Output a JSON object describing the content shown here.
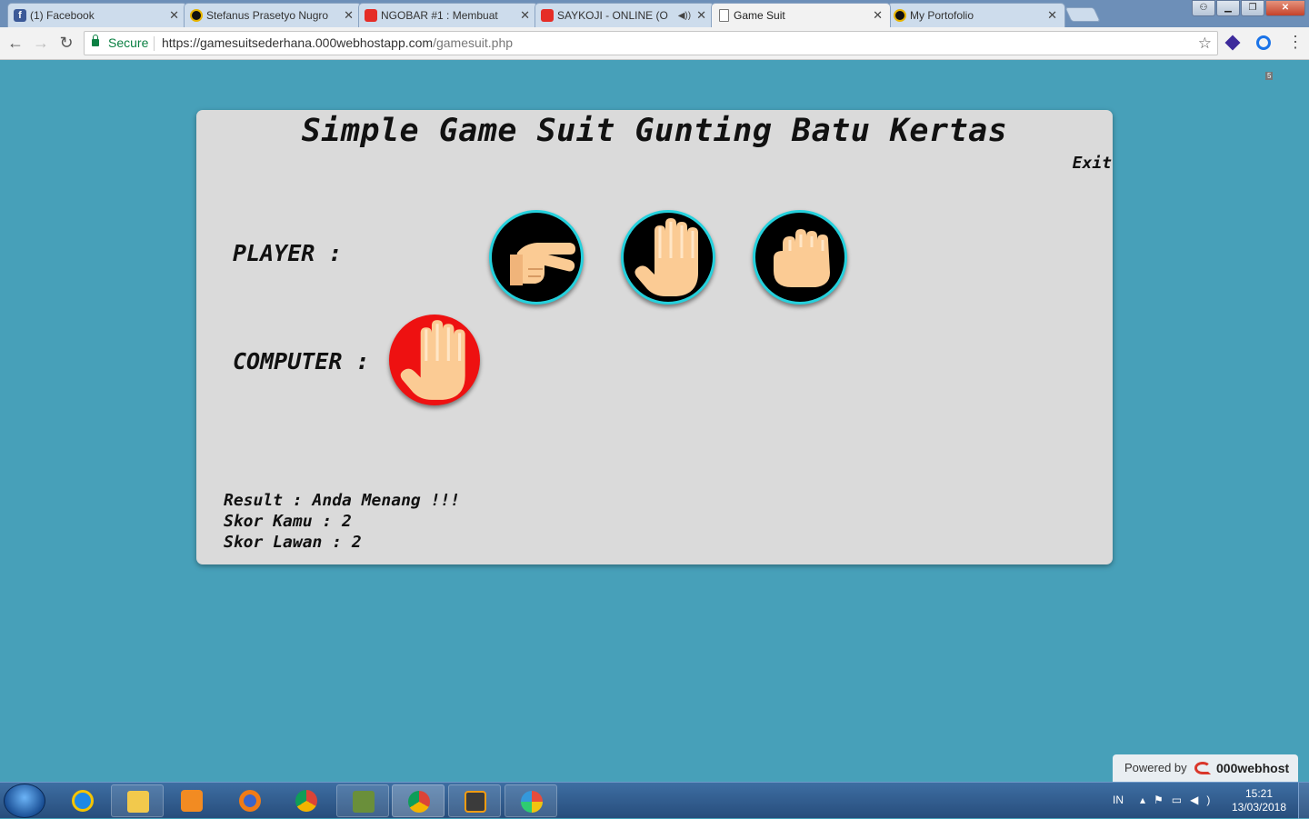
{
  "browser": {
    "tabs": [
      {
        "title": "(1) Facebook",
        "favicon": "facebook-icon",
        "active": false
      },
      {
        "title": "Stefanus Prasetyo Nugro",
        "favicon": "incredibles-icon",
        "active": false
      },
      {
        "title": "NGOBAR #1 : Membuat",
        "favicon": "youtube-icon",
        "active": false
      },
      {
        "title": "SAYKOJI - ONLINE (O",
        "favicon": "youtube-icon",
        "active": false
      },
      {
        "title": "Game Suit",
        "favicon": "document-icon",
        "active": true
      },
      {
        "title": "My Portofolio",
        "favicon": "incredibles-icon",
        "active": false
      }
    ],
    "secure_label": "Secure",
    "url_host": "https://gamesuitsederhana.000webhostapp.com",
    "url_path": "/gamesuit.php",
    "extension_badge": "5"
  },
  "game": {
    "title": "Simple Game Suit Gunting Batu Kertas",
    "exit_label": "Exit",
    "player_label": "PLAYER :",
    "computer_label": "COMPUTER :",
    "player_choices": [
      "scissors-hand-icon",
      "paper-hand-icon",
      "rock-hand-icon"
    ],
    "computer_choice": "paper-hand-icon",
    "result_line": "Result : Anda Menang !!!",
    "score_you_line": "Skor Kamu : 2",
    "score_opponent_line": "Skor Lawan : 2",
    "colors": {
      "background": "#47a0b9",
      "card": "#dadada",
      "choice_ring": "#25d1dd",
      "computer_circle": "#ee1111",
      "skin": "#fbcb94"
    }
  },
  "hosting_badge": {
    "powered_by": "Powered by",
    "brand": "000webhost"
  },
  "taskbar": {
    "language": "IN",
    "time": "15:21",
    "date": "13/03/2018"
  }
}
